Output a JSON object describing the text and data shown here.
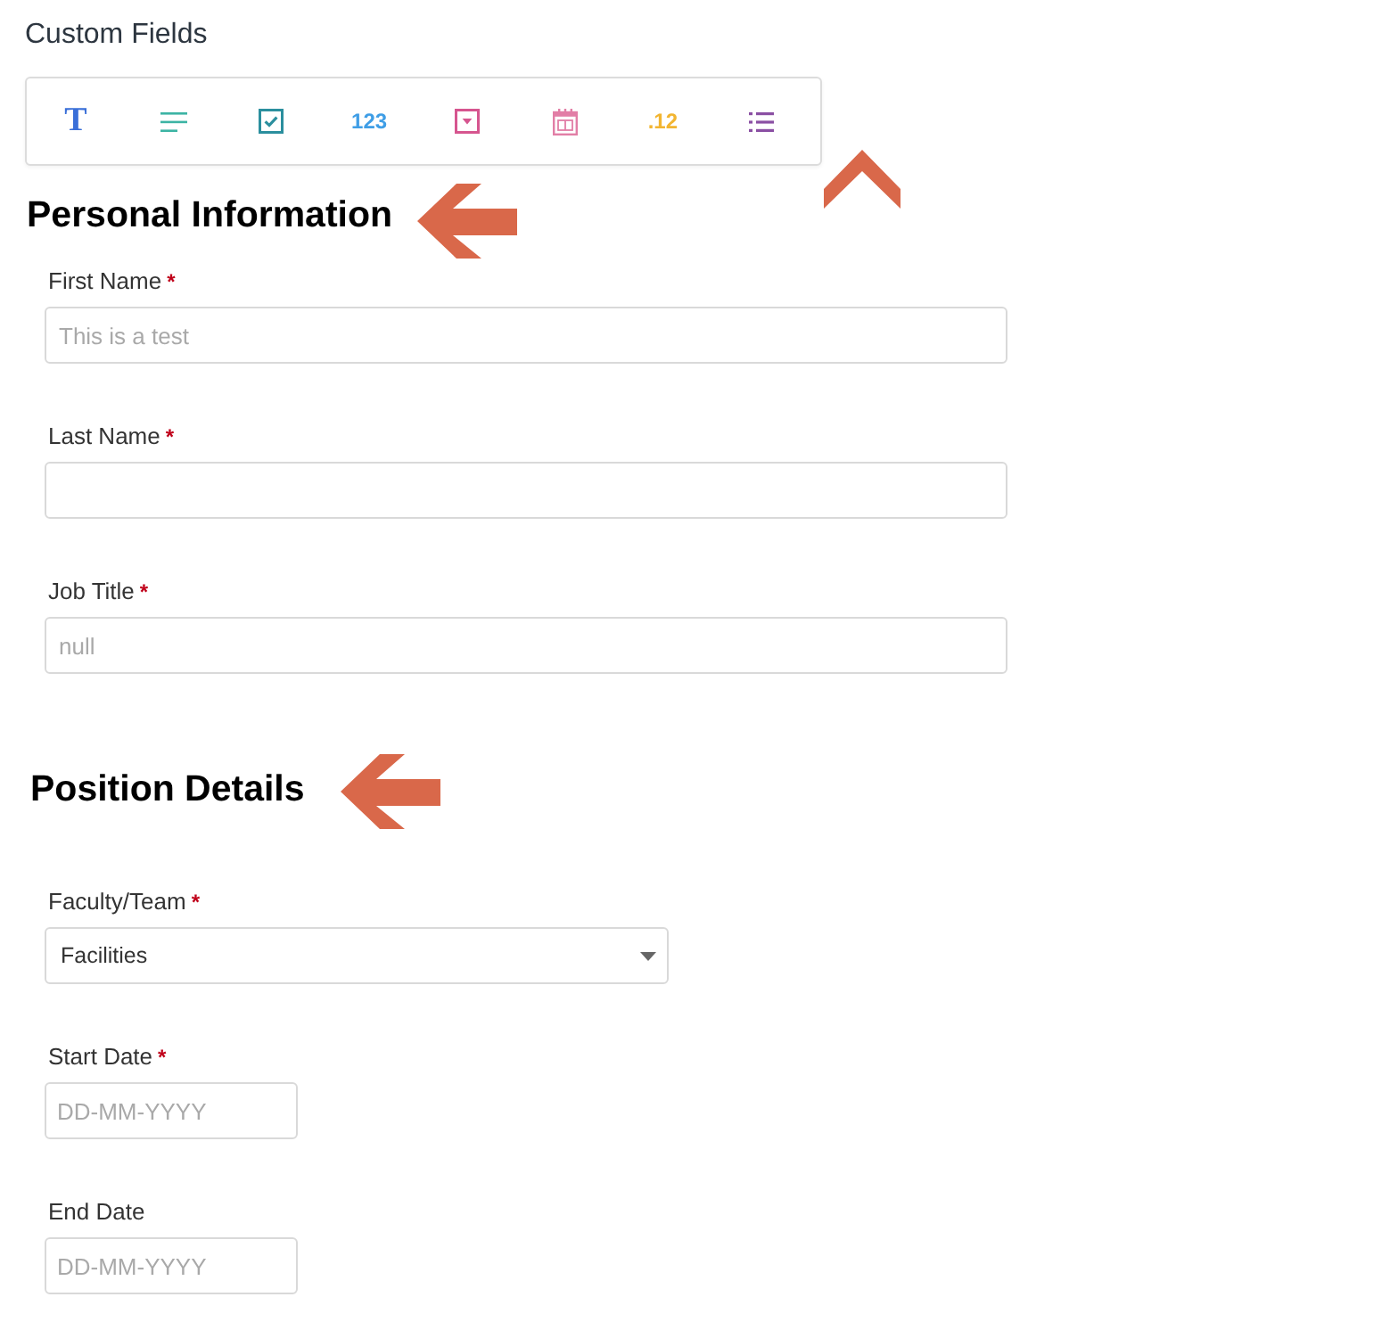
{
  "title": "Custom Fields",
  "toolbar": {
    "items": [
      {
        "kind": "letter",
        "glyph": "T",
        "color": "#3a6fd8"
      },
      {
        "kind": "paragraph",
        "color": "#3cb4a4"
      },
      {
        "kind": "checkbox",
        "color": "#2b8f9e"
      },
      {
        "kind": "number",
        "glyph": "123",
        "color": "#3f9ee6"
      },
      {
        "kind": "dropdown",
        "color": "#d6558f"
      },
      {
        "kind": "calendar",
        "color": "#e27ea6"
      },
      {
        "kind": "number",
        "glyph": ".12",
        "color": "#f2b531"
      },
      {
        "kind": "list",
        "color": "#8a4fa3"
      }
    ]
  },
  "sections": [
    {
      "heading": "Personal Information",
      "fields": [
        {
          "kind": "text",
          "label": "First Name",
          "required_mark": "*",
          "placeholder": "This is a test"
        },
        {
          "kind": "text",
          "label": "Last Name",
          "required_mark": "*"
        },
        {
          "kind": "text",
          "label": "Job Title",
          "required_mark": "*",
          "placeholder": "null"
        }
      ]
    },
    {
      "heading": "Position Details",
      "fields": [
        {
          "kind": "select",
          "label": "Faculty/Team",
          "required_mark": "*",
          "value": "Facilities"
        },
        {
          "kind": "date",
          "label": "Start Date",
          "required_mark": "*",
          "placeholder": "DD-MM-YYYY"
        },
        {
          "kind": "date",
          "label": "End Date",
          "placeholder": "DD-MM-YYYY"
        }
      ]
    }
  ]
}
